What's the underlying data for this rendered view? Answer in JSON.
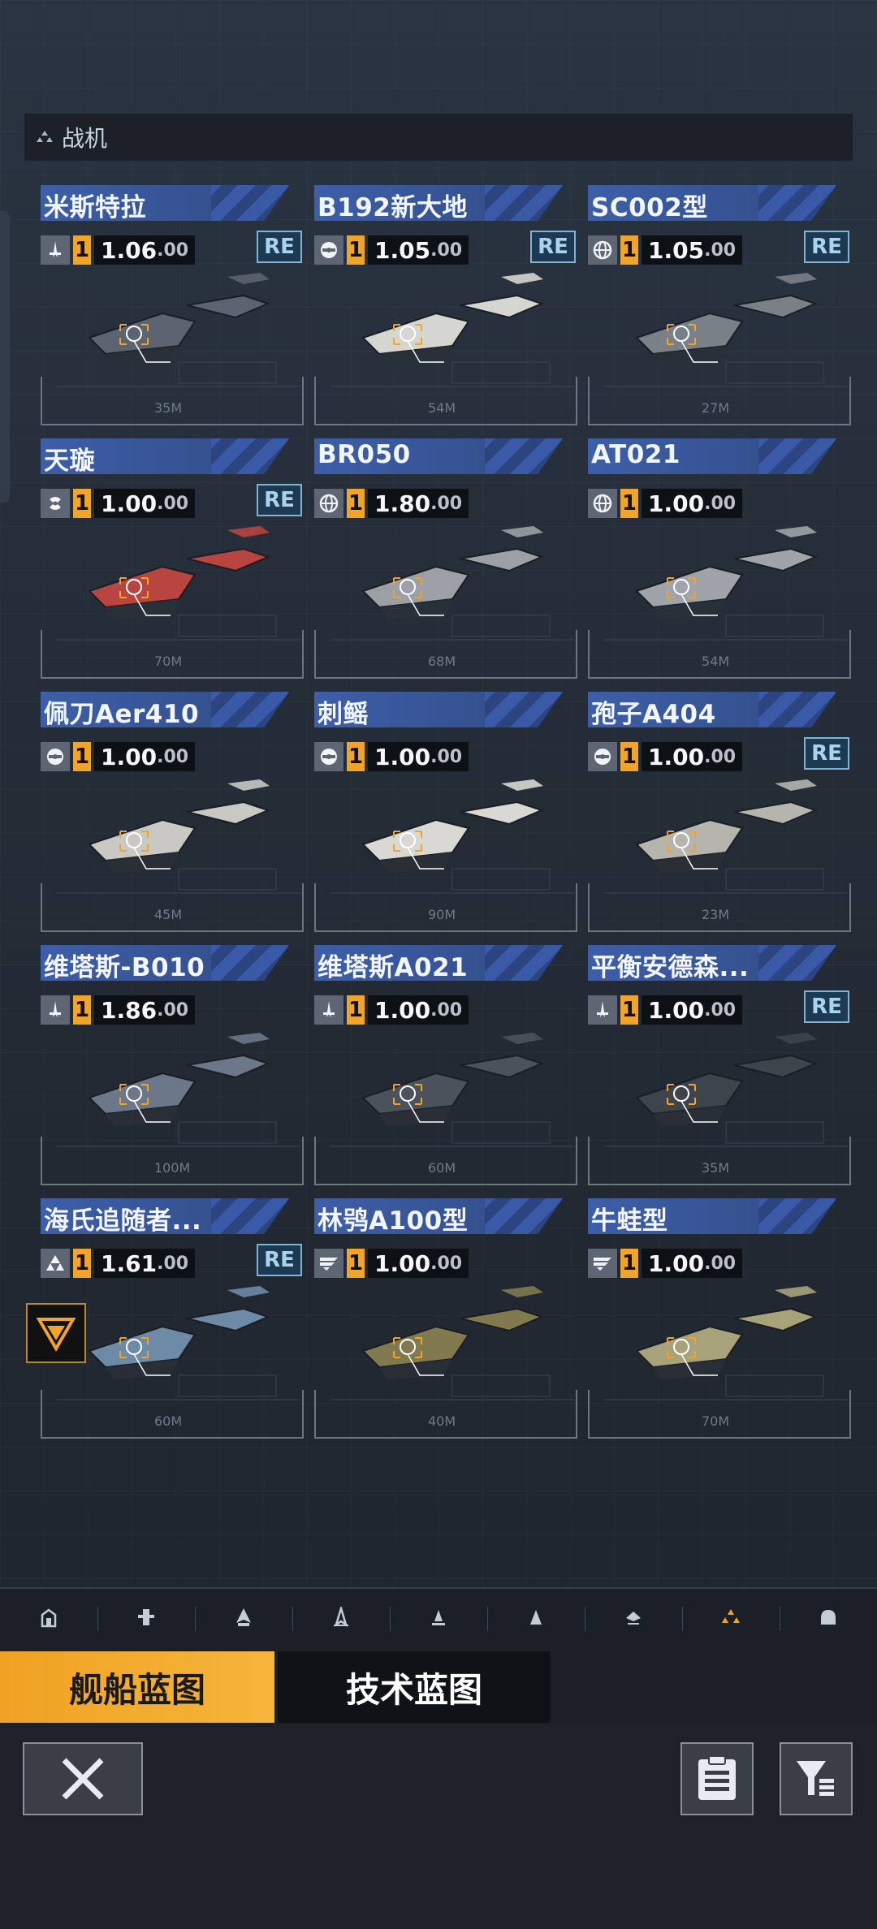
{
  "section": {
    "title": "战机"
  },
  "ships": [
    {
      "name": "米斯特拉",
      "icon": "fighter-icon",
      "level": "1",
      "value": "1.06",
      "decimals": ".00",
      "re": true,
      "size": "35M",
      "hull": "#5b6470"
    },
    {
      "name": "B192新大地",
      "icon": "faction-icon",
      "level": "1",
      "value": "1.05",
      "decimals": ".00",
      "re": true,
      "size": "54M",
      "hull": "#d6d6d0"
    },
    {
      "name": "SC002型",
      "icon": "globe-icon",
      "level": "1",
      "value": "1.05",
      "decimals": ".00",
      "re": true,
      "size": "27M",
      "hull": "#7a8088"
    },
    {
      "name": "天璇",
      "icon": "swirl-icon",
      "level": "1",
      "value": "1.00",
      "decimals": ".00",
      "re": true,
      "size": "70M",
      "hull": "#b8453f"
    },
    {
      "name": "BR050",
      "icon": "globe-icon",
      "level": "1",
      "value": "1.80",
      "decimals": ".00",
      "re": false,
      "size": "68M",
      "hull": "#9ca0a6"
    },
    {
      "name": "AT021",
      "icon": "globe-icon",
      "level": "1",
      "value": "1.00",
      "decimals": ".00",
      "re": false,
      "size": "54M",
      "hull": "#9fa4aa"
    },
    {
      "name": "佩刀Aer410",
      "icon": "faction-icon",
      "level": "1",
      "value": "1.00",
      "decimals": ".00",
      "re": false,
      "size": "45M",
      "hull": "#c9c8c2"
    },
    {
      "name": "刺鳐",
      "icon": "faction-icon",
      "level": "1",
      "value": "1.00",
      "decimals": ".00",
      "re": false,
      "size": "90M",
      "hull": "#d9d8d2"
    },
    {
      "name": "孢子A404",
      "icon": "faction-icon",
      "level": "1",
      "value": "1.00",
      "decimals": ".00",
      "re": true,
      "size": "23M",
      "hull": "#b6b5ad"
    },
    {
      "name": "维塔斯-B010",
      "icon": "fighter-icon",
      "level": "1",
      "value": "1.86",
      "decimals": ".00",
      "re": false,
      "size": "100M",
      "hull": "#6c7889"
    },
    {
      "name": "维塔斯A021",
      "icon": "fighter-icon",
      "level": "1",
      "value": "1.00",
      "decimals": ".00",
      "re": false,
      "size": "60M",
      "hull": "#4a525c"
    },
    {
      "name": "平衡安德森...",
      "icon": "fighter-icon",
      "level": "1",
      "value": "1.00",
      "decimals": ".00",
      "re": true,
      "size": "35M",
      "hull": "#3e444c"
    },
    {
      "name": "海氏追随者...",
      "icon": "triangle-icon",
      "level": "1",
      "value": "1.61",
      "decimals": ".00",
      "re": true,
      "size": "60M",
      "hull": "#6d8aa6"
    },
    {
      "name": "林鸮A100型",
      "icon": "stripe-icon",
      "level": "1",
      "value": "1.00",
      "decimals": ".00",
      "re": false,
      "size": "40M",
      "hull": "#807a4e"
    },
    {
      "name": "牛蛙型",
      "icon": "stripe-icon",
      "level": "1",
      "value": "1.00",
      "decimals": ".00",
      "re": false,
      "size": "70M",
      "hull": "#a7a27a"
    }
  ],
  "re_label": "RE",
  "categories": [
    "station-icon",
    "carrier-icon",
    "destroyer-icon",
    "frigate-icon",
    "corvette-icon",
    "fighter-class-icon",
    "drone-icon",
    "squadron-icon",
    "dome-icon"
  ],
  "active_category_index": 7,
  "tabs": {
    "ship": "舰船蓝图",
    "tech": "技术蓝图"
  },
  "colors": {
    "accent": "#f0a52a",
    "blue": "#3a5aa8",
    "re": "#7fb4d6"
  }
}
